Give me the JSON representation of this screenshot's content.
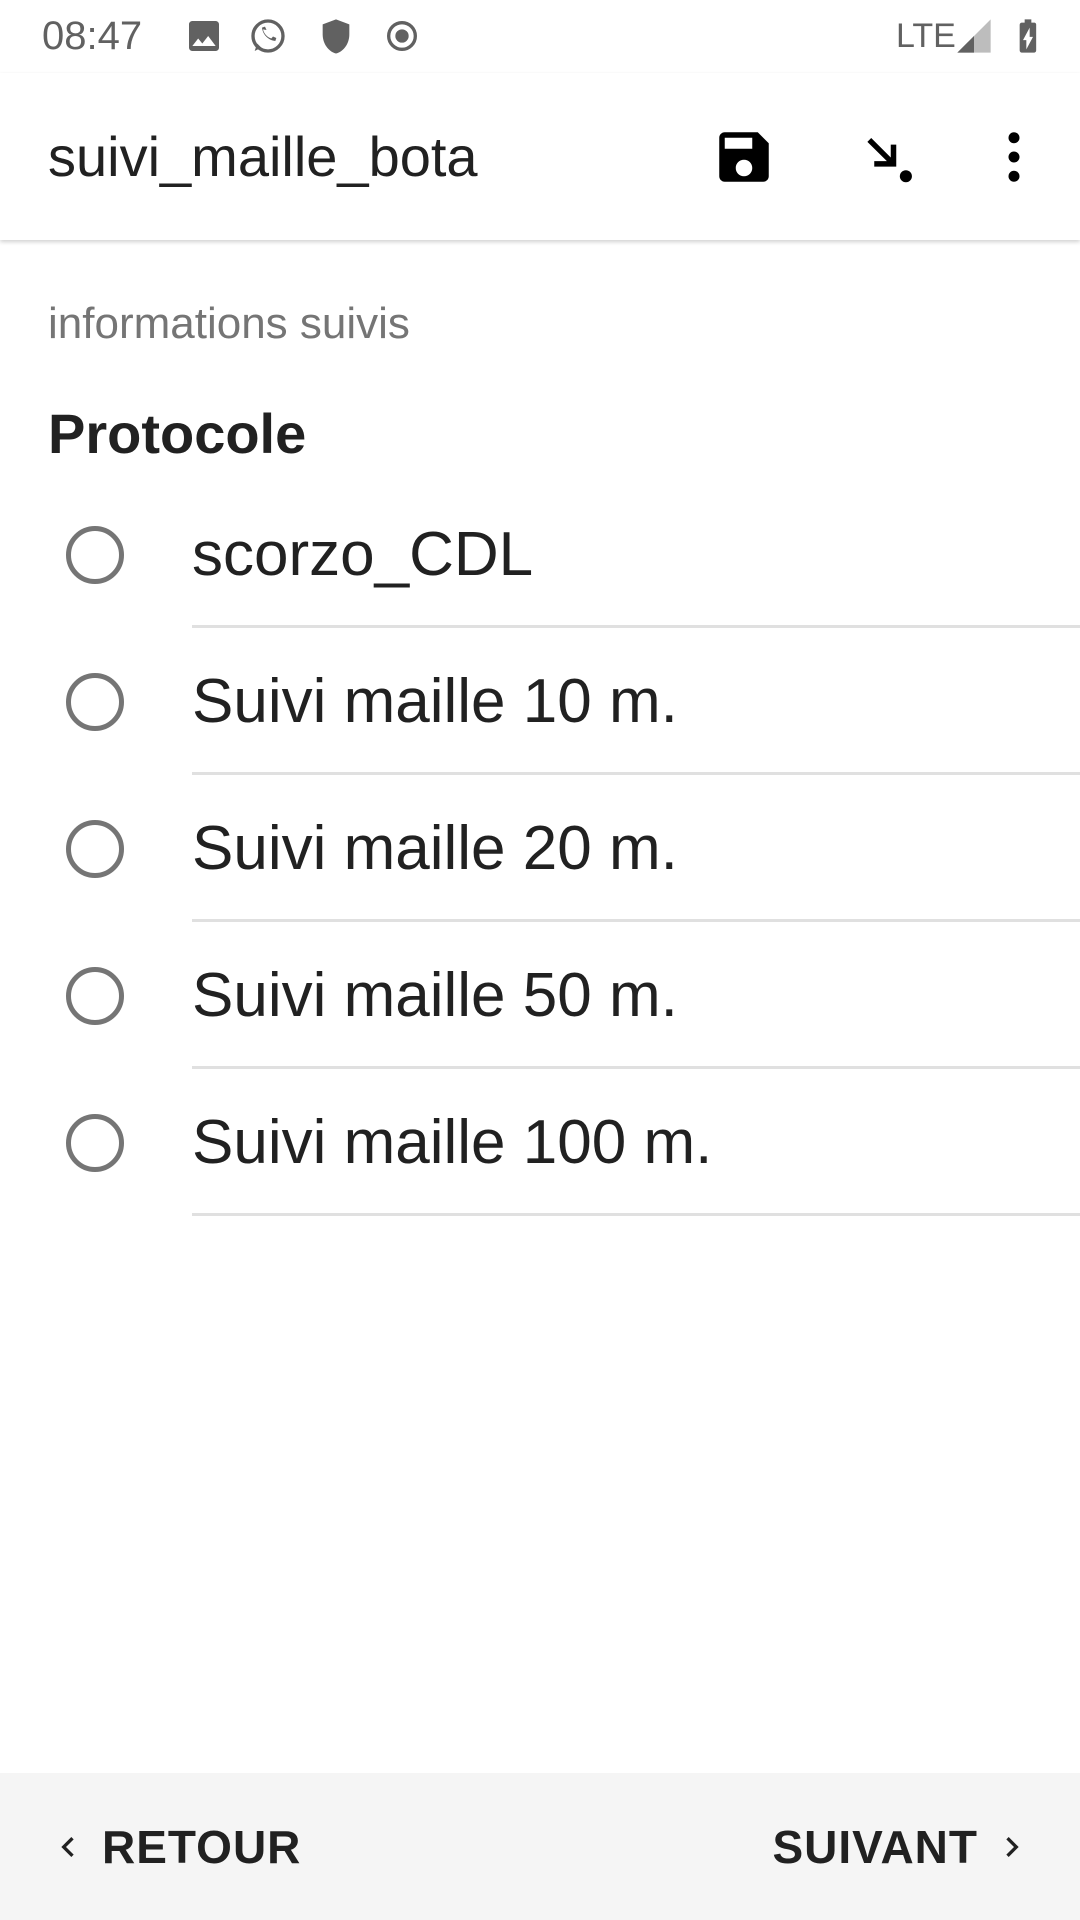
{
  "status_bar": {
    "time": "08:47",
    "network": "LTE",
    "left_icons": [
      "image-icon",
      "whatsapp-icon",
      "shield-icon",
      "record-icon"
    ],
    "right_icons": [
      "signal-icon",
      "battery-charging-icon"
    ]
  },
  "app_bar": {
    "title": "suivi_maille_bota",
    "actions": [
      "save-icon",
      "go-to-icon",
      "more-vert-icon"
    ]
  },
  "form": {
    "section_label": "informations suivis",
    "question": "Protocole",
    "options": [
      {
        "label": "scorzo_CDL",
        "selected": false
      },
      {
        "label": "Suivi maille 10 m.",
        "selected": false
      },
      {
        "label": "Suivi maille 20 m.",
        "selected": false
      },
      {
        "label": "Suivi maille 50 m.",
        "selected": false
      },
      {
        "label": "Suivi maille 100 m.",
        "selected": false
      }
    ]
  },
  "navigation": {
    "back_label": "RETOUR",
    "next_label": "SUIVANT"
  },
  "colors": {
    "text_primary": "#212121",
    "text_secondary": "#757575",
    "divider": "#e0e0e0",
    "bottom_bar": "#f5f5f5"
  }
}
